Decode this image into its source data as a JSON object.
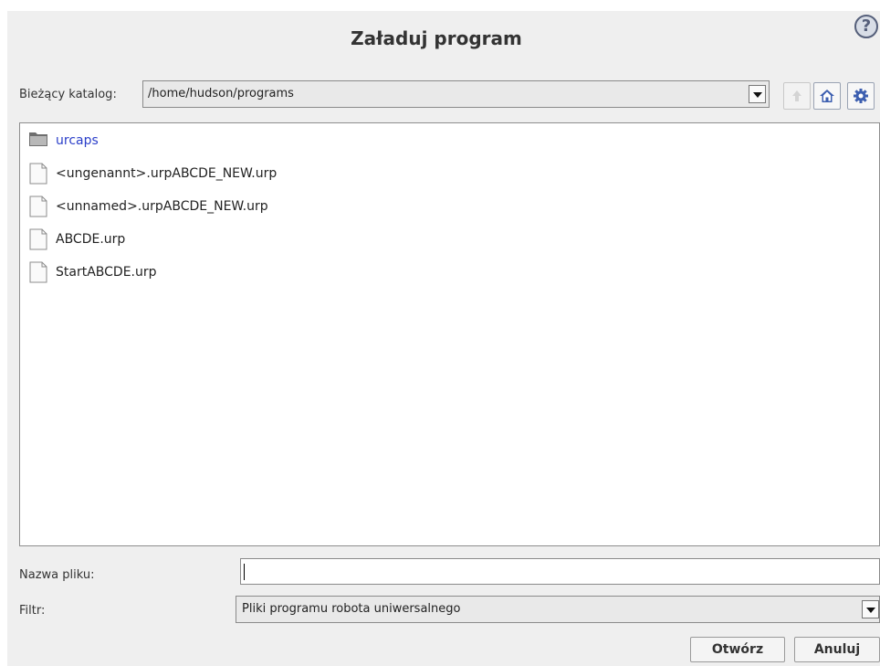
{
  "dialog": {
    "title": "Załaduj program",
    "help_icon": "?"
  },
  "location": {
    "label": "Bieżący katalog:",
    "path": "/home/hudson/programs"
  },
  "toolbar": {
    "icons": [
      "up-folder-icon",
      "home-icon",
      "gear-icon"
    ]
  },
  "files": [
    {
      "name": "urcaps",
      "type": "folder"
    },
    {
      "name": "<ungenannt>.urpABCDE_NEW.urp",
      "type": "file"
    },
    {
      "name": "<unnamed>.urpABCDE_NEW.urp",
      "type": "file"
    },
    {
      "name": "ABCDE.urp",
      "type": "file"
    },
    {
      "name": "StartABCDE.urp",
      "type": "file"
    }
  ],
  "filename": {
    "label": "Nazwa pliku:",
    "value": ""
  },
  "filter": {
    "label": "Filtr:",
    "selected": "Pliki programu robota uniwersalnego"
  },
  "actions": {
    "open": "Otwórz",
    "cancel": "Anuluj"
  },
  "colors": {
    "folder_text": "#2a3ec9",
    "dialog_bg": "#efefef"
  }
}
